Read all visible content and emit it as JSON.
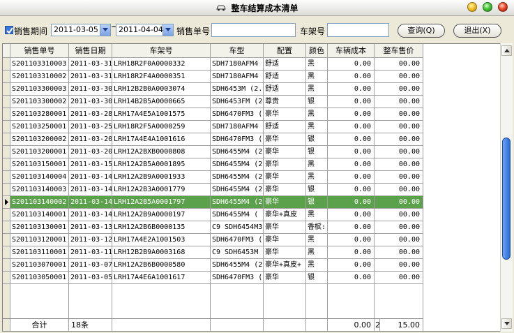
{
  "window": {
    "title": "整车结算成本清单"
  },
  "filters": {
    "period_label": "销售期间",
    "date_from": "2011-03-05",
    "tilde": "~",
    "date_to": "2011-04-04",
    "order_no_label": "销售单号",
    "order_no_value": "",
    "vin_label": "车架号",
    "vin_value": ""
  },
  "buttons": {
    "query": "查询(Q)",
    "exit": "退出(X)"
  },
  "table": {
    "columns": [
      "销售单号",
      "销售日期",
      "车架号",
      "车型",
      "配置",
      "颜色",
      "车辆成本",
      "整车售价"
    ],
    "selected_row": 11,
    "rows": [
      [
        "S201103310003",
        "2011-03-31",
        "LRH18R2F0A0000332",
        "SDH7180AFM4 (",
        "舒适",
        "黑",
        "0.00",
        "00.00"
      ],
      [
        "S201103310002",
        "2011-03-31",
        "LRH18R2F4A0000351",
        "SDH7180AFM4 (",
        "舒适",
        "黑",
        "0.00",
        "00.00"
      ],
      [
        "S201103300003",
        "2011-03-30",
        "LRH12B2B0A0003074",
        "SDH6453M (2.0",
        "舒适",
        "黑",
        "0.00",
        "00.00"
      ],
      [
        "S201103300002",
        "2011-03-30",
        "LRH14B2B5A0000665",
        "SDH6453FM (2.0",
        "尊贵",
        "银",
        "0.00",
        "00.00"
      ],
      [
        "S201103280001",
        "2011-03-28",
        "LRH17A4E5A1001575",
        "SDH6470FM3 (",
        "豪华",
        "黑",
        "0.00",
        "00.00"
      ],
      [
        "S201103250001",
        "2011-03-25",
        "LRH18R2F5A0000259",
        "SDH7180AFM4 (",
        "舒适",
        "黑",
        "0.00",
        "00.00"
      ],
      [
        "S201103200002",
        "2011-03-20",
        "LRH17A4E4A1001616",
        "SDH6470FM3 (",
        "豪华",
        "银",
        "0.00",
        "00.00"
      ],
      [
        "S201103200001",
        "2011-03-20",
        "LRH12A2BXB0000808",
        "SDH6455M4 (2.0",
        "豪华",
        "银",
        "0.00",
        "00.00"
      ],
      [
        "S201103150001",
        "2011-03-15",
        "LRH12A2B5A0001895",
        "SDH6455M4 (2.0",
        "豪华",
        "黑",
        "0.00",
        "00.00"
      ],
      [
        "S201103140004",
        "2011-03-14",
        "LRH12A2B9A0001933",
        "SDH6455M4 (2.0",
        "豪华",
        "黑",
        "0.00",
        "00.00"
      ],
      [
        "S201103140003",
        "2011-03-14",
        "LRH12A2B3A0001779",
        "SDH6455M4 (2.0",
        "豪华",
        "银",
        "0.00",
        "00.00"
      ],
      [
        "S201103140002",
        "2011-03-14",
        "LRH12A2B5A0001797",
        "SDH6455M4 (2.0",
        "豪华",
        "银",
        "0.00",
        "00.00"
      ],
      [
        "S201103140001",
        "2011-03-14",
        "LRH12A2B9A0000197",
        "SDH6455M4 ( 2",
        "豪华+真皮",
        "黑",
        "0.00",
        "00.00"
      ],
      [
        "S201103130001",
        "2011-03-13",
        "LRH12A2B6B0000135",
        "C9 SDH6454M3",
        "豪华",
        "香槟:",
        "0.00",
        "00.00"
      ],
      [
        "S201103120001",
        "2011-03-12",
        "LRH17A4E2A1001503",
        "SDH6470FM3 (",
        "豪华",
        "黑",
        "0.00",
        "00.00"
      ],
      [
        "S201103110001",
        "2011-03-11",
        "LRH12B2B9A0003168",
        "C9  SDH6453M",
        "豪华",
        "黑",
        "0.00",
        "00.00"
      ],
      [
        "S201103070001",
        "2011-03-07",
        "LRH12A2B6B0000580",
        "SDH6455M4 (2.0",
        "豪华+真皮+",
        "黑",
        "0.00",
        "00.00"
      ],
      [
        "S201103050001",
        "2011-03-05",
        "LRH17A4E6A1001617",
        "SDH6470FM3 (",
        "豪华",
        "银",
        "0.00",
        "00.00"
      ]
    ],
    "footer": {
      "label": "合计",
      "count": "18条",
      "cost_total": "0.00",
      "price_total_a": "2",
      "price_total_b": "15.00"
    }
  },
  "colors": {
    "selected_row_bg": "#5ba04b",
    "scroll_thumb": "#2b6ad6"
  },
  "icons": {
    "app": "car-icon",
    "row_pointer": "row-pointer-icon"
  }
}
